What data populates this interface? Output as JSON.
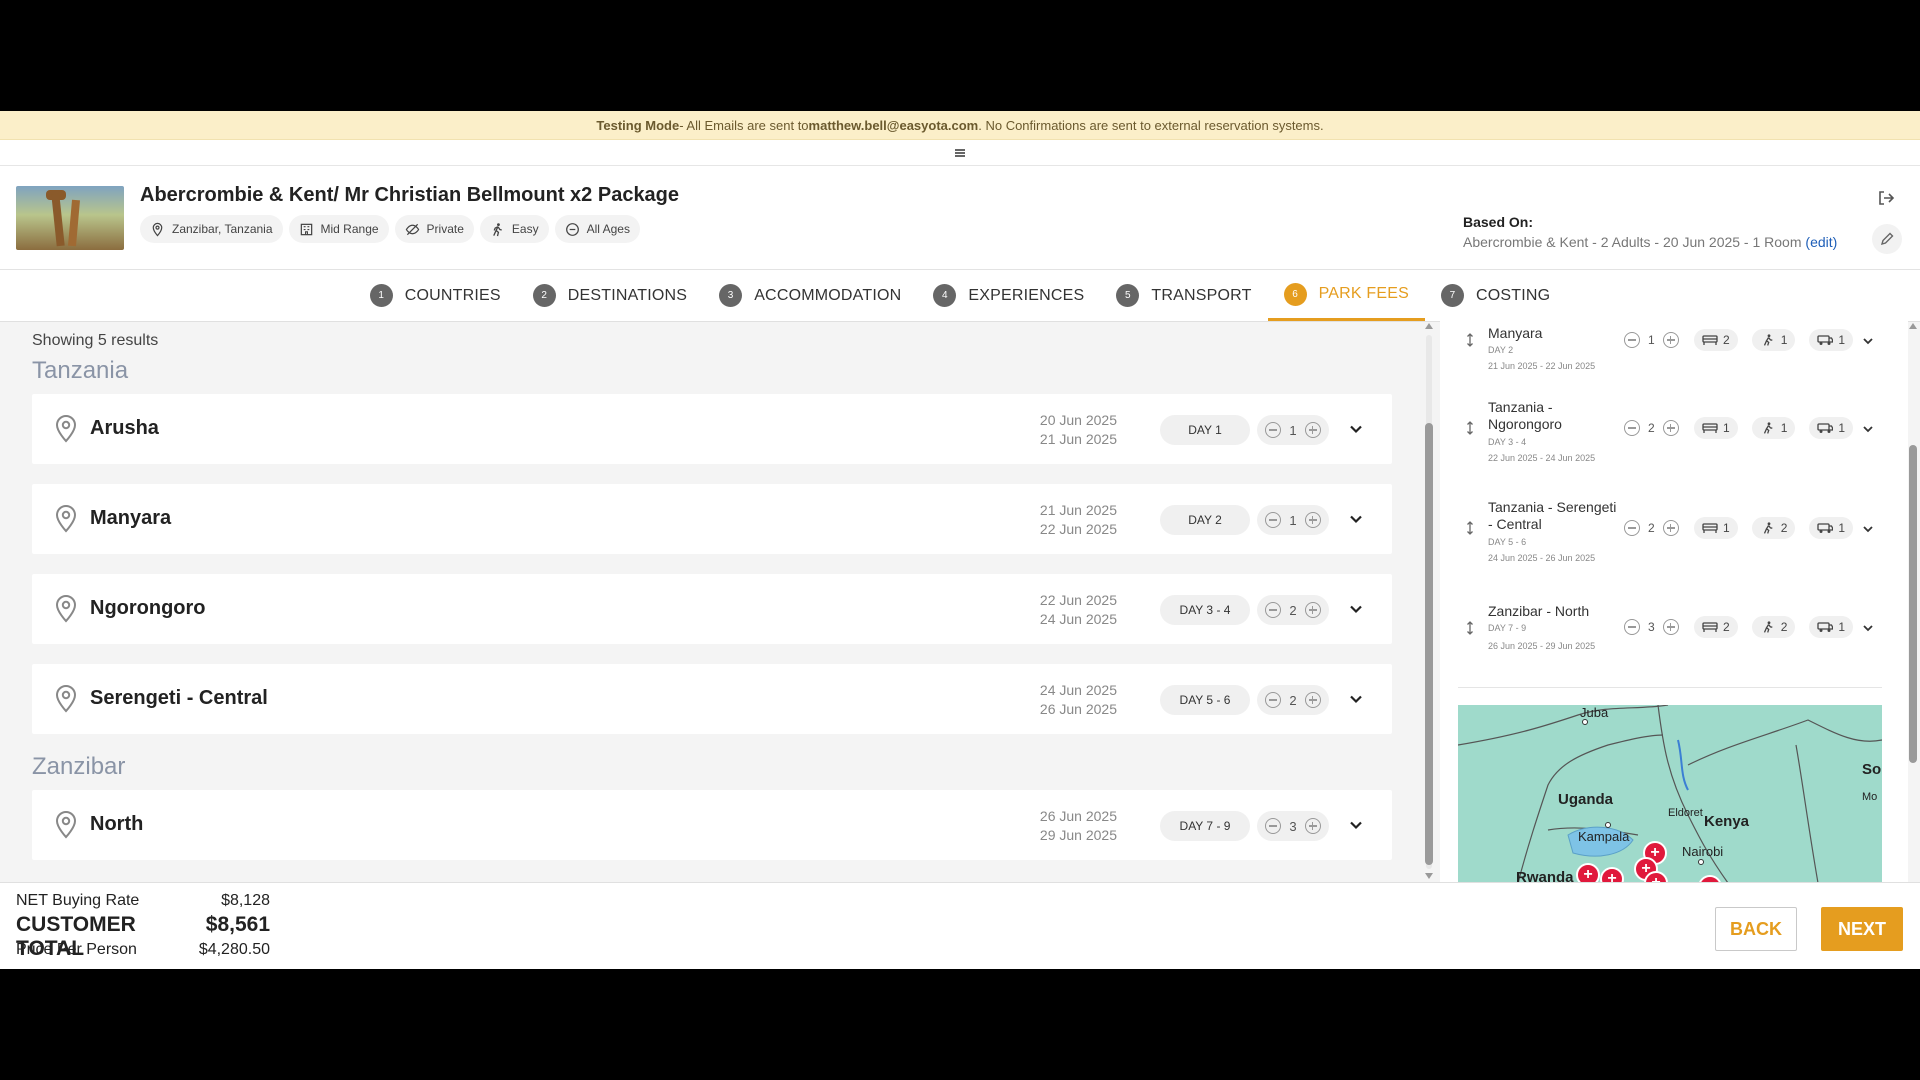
{
  "banner": {
    "mode": "Testing Mode",
    "pre": " - All Emails are sent to ",
    "email": "matthew.bell@easyota.com",
    "post": ". No Confirmations are sent to external reservation systems."
  },
  "header": {
    "title": "Abercrombie & Kent/ Mr Christian Bellmount x2 Package",
    "tags": [
      "Zanzibar, Tanzania",
      "Mid Range",
      "Private",
      "Easy",
      "All Ages"
    ],
    "based_label": "Based On:",
    "based_value": "Abercrombie & Kent - 2 Adults - 20 Jun 2025 - 1 Room ",
    "edit_label": "(edit)"
  },
  "tabs": [
    {
      "num": "1",
      "label": "COUNTRIES"
    },
    {
      "num": "2",
      "label": "DESTINATIONS"
    },
    {
      "num": "3",
      "label": "ACCOMMODATION"
    },
    {
      "num": "4",
      "label": "EXPERIENCES"
    },
    {
      "num": "5",
      "label": "TRANSPORT"
    },
    {
      "num": "6",
      "label": "PARK FEES"
    },
    {
      "num": "7",
      "label": "COSTING"
    }
  ],
  "main": {
    "showing": "Showing 5 results",
    "regions": [
      "Tanzania",
      "Zanzibar"
    ],
    "cards": [
      {
        "name": "Arusha",
        "date1": "20 Jun 2025",
        "date2": "21 Jun 2025",
        "day": "DAY 1",
        "count": "1"
      },
      {
        "name": "Manyara",
        "date1": "21 Jun 2025",
        "date2": "22 Jun 2025",
        "day": "DAY 2",
        "count": "1"
      },
      {
        "name": "Ngorongoro",
        "date1": "22 Jun 2025",
        "date2": "24 Jun 2025",
        "day": "DAY 3 - 4",
        "count": "2"
      },
      {
        "name": "Serengeti - Central",
        "date1": "24 Jun 2025",
        "date2": "26 Jun 2025",
        "day": "DAY 5 - 6",
        "count": "2"
      },
      {
        "name": "North",
        "date1": "26 Jun 2025",
        "date2": "29 Jun 2025",
        "day": "DAY 7 - 9",
        "count": "3"
      }
    ]
  },
  "right": {
    "items": [
      {
        "name": "Manyara",
        "day": "DAY 2",
        "dates": "21 Jun 2025 - 22 Jun 2025",
        "nights": "1",
        "beds": "2",
        "people": "1",
        "vehicles": "1"
      },
      {
        "name": "Tanzania - Ngorongoro",
        "day": "DAY 3 - 4",
        "dates": "22 Jun 2025 - 24 Jun 2025",
        "nights": "2",
        "beds": "1",
        "people": "1",
        "vehicles": "1"
      },
      {
        "name": "Tanzania - Serengeti - Central",
        "day": "DAY 5 - 6",
        "dates": "24 Jun 2025 - 26 Jun 2025",
        "nights": "2",
        "beds": "1",
        "people": "2",
        "vehicles": "1"
      },
      {
        "name": "Zanzibar - North",
        "day": "DAY 7 - 9",
        "dates": "26 Jun 2025 - 29 Jun 2025",
        "nights": "3",
        "beds": "2",
        "people": "2",
        "vehicles": "1"
      }
    ],
    "map_labels": {
      "juba": "Juba",
      "uganda": "Uganda",
      "kenya": "Kenya",
      "eldoret": "Eldoret",
      "kampala": "Kampala",
      "nairobi": "Nairobi",
      "rwanda": "Rwanda",
      "so": "So",
      "mo": "Mo"
    }
  },
  "footer": {
    "net_label": "NET Buying Rate",
    "net_value": "$8,128",
    "total_label": "CUSTOMER TOTAL",
    "total_value": "$8,561",
    "ppp_label": "Price Per Person",
    "ppp_value": "$4,280.50",
    "back": "BACK",
    "next": "NEXT"
  },
  "colors": {
    "accent": "#e59d1f",
    "banner_bg": "#fbefc9",
    "marker": "#e0193c",
    "map": "#9fdacb"
  }
}
